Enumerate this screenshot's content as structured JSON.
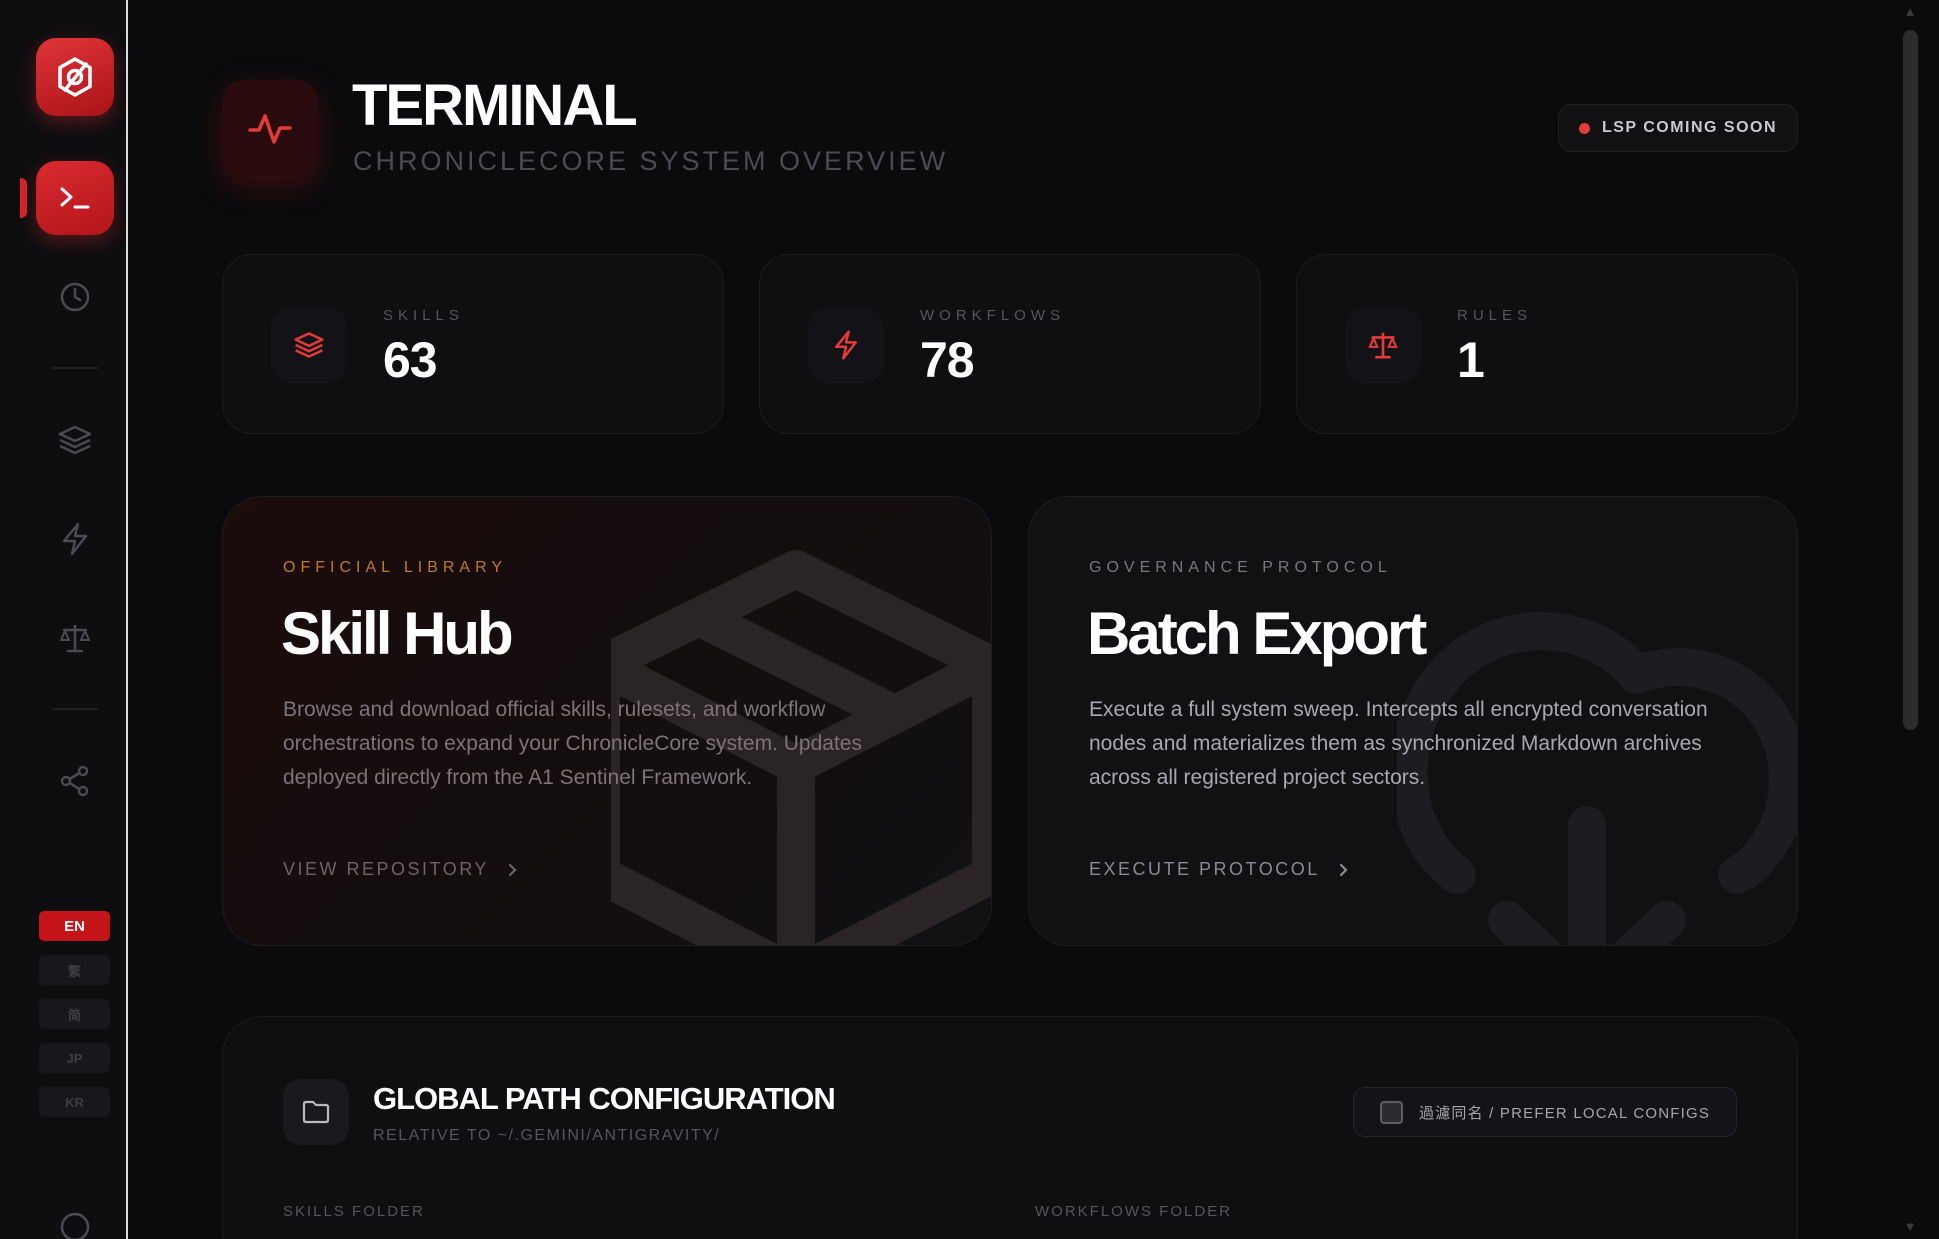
{
  "header": {
    "title": "TERMINAL",
    "subtitle": "CHRONICLECORE SYSTEM OVERVIEW",
    "status": "LSP COMING SOON"
  },
  "stats": [
    {
      "label": "SKILLS",
      "value": "63",
      "icon": "layers-icon"
    },
    {
      "label": "WORKFLOWS",
      "value": "78",
      "icon": "lightning-icon"
    },
    {
      "label": "RULES",
      "value": "1",
      "icon": "scale-icon"
    }
  ],
  "skill_hub": {
    "eyebrow": "OFFICIAL LIBRARY",
    "title": "Skill Hub",
    "description": "Browse and download official skills, rulesets, and workflow orchestrations to expand your ChronicleCore system. Updates deployed directly from the A1 Sentinel Framework.",
    "action": "VIEW REPOSITORY"
  },
  "batch_export": {
    "eyebrow": "GOVERNANCE PROTOCOL",
    "title": "Batch Export",
    "description": "Execute a full system sweep. Intercepts all encrypted conversation nodes and materializes them as synchronized Markdown archives across all registered project sectors.",
    "action": "EXECUTE PROTOCOL"
  },
  "config": {
    "title": "GLOBAL PATH CONFIGURATION",
    "subtitle": "RELATIVE TO ~/.GEMINI/ANTIGRAVITY/",
    "toggle_label": "過濾同名 / PREFER LOCAL CONFIGS",
    "skills_folder_label": "SKILLS FOLDER",
    "workflows_folder_label": "WORKFLOWS FOLDER"
  },
  "languages": [
    {
      "label": "EN",
      "active": true
    },
    {
      "label": "繁",
      "active": false
    },
    {
      "label": "简",
      "active": false
    },
    {
      "label": "JP",
      "active": false
    },
    {
      "label": "KR",
      "active": false
    }
  ],
  "colors": {
    "accent": "#d42328",
    "hub_eyebrow": "#c0782e",
    "background": "#0b0b0d"
  }
}
